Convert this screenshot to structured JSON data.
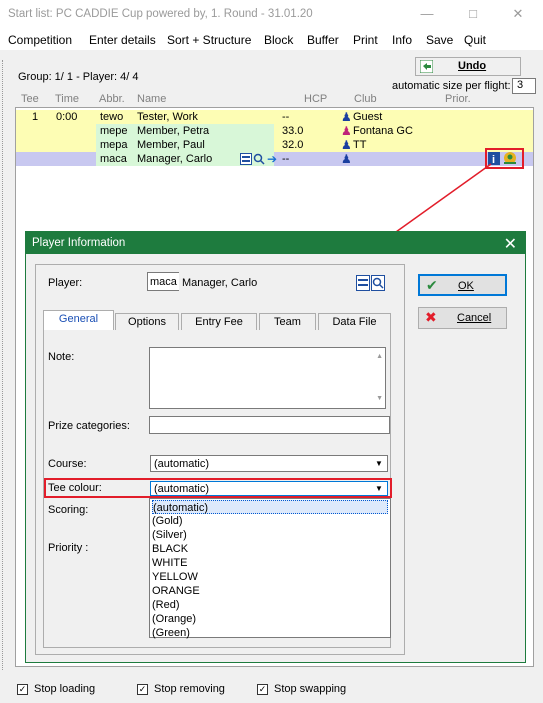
{
  "window": {
    "title": "Start list: PC CADDIE Cup powered by, 1. Round - 31.01.20"
  },
  "menu": [
    "Competition",
    "Enter details",
    "Sort + Structure",
    "Block",
    "Buffer",
    "Print",
    "Info",
    "Save",
    "Quit"
  ],
  "toolbar": {
    "group_label": "Group:  1/  1 - Player:  4/  4",
    "undo_label": "Undo",
    "auto_size_label": "automatic size per flight:",
    "auto_size_value": "3"
  },
  "table": {
    "headers": [
      "Tee",
      "Time",
      "Abbr.",
      "Name",
      "HCP",
      "Club",
      "Prior."
    ],
    "rows": [
      {
        "tee": "1",
        "time": "0:00",
        "abbr": "tewo",
        "name": "Tester, Work",
        "hcp": "--",
        "club": "Guest"
      },
      {
        "tee": "",
        "time": "",
        "abbr": "mepe",
        "name": "Member, Petra",
        "hcp": "33.0",
        "club": "Fontana GC"
      },
      {
        "tee": "",
        "time": "",
        "abbr": "mepa",
        "name": "Member, Paul",
        "hcp": "32.0",
        "club": "TT"
      },
      {
        "tee": "",
        "time": "",
        "abbr": "maca",
        "name": "Manager, Carlo",
        "hcp": "--",
        "club": ""
      }
    ]
  },
  "dialog": {
    "title": "Player Information",
    "player_label": "Player:",
    "player_abbr": "maca",
    "player_name": "Manager, Carlo",
    "ok_label": "OK",
    "cancel_label": "Cancel",
    "tabs": [
      "General",
      "Options",
      "Entry Fee",
      "Team",
      "Data File"
    ],
    "note_label": "Note:",
    "prize_label": "Prize categories:",
    "course_label": "Course:",
    "course_value": "(automatic)",
    "tee_colour_label": "Tee colour:",
    "tee_colour_value": "(automatic)",
    "scoring_label": "Scoring:",
    "priority_label": "Priority :",
    "tee_colour_options": [
      "(automatic)",
      "(Gold)",
      "(Silver)",
      "BLACK",
      "WHITE",
      "YELLOW",
      "ORANGE",
      "(Red)",
      "(Orange)",
      "(Green)"
    ]
  },
  "bottom": {
    "stop_loading": "Stop loading",
    "stop_removing": "Stop removing",
    "stop_swapping": "Stop swapping"
  },
  "colors": {
    "accent": "#1e7b3e",
    "highlight": "#e21d2a",
    "selected_row": "#c8c8f0",
    "row_yellow": "#fdfdb4"
  }
}
